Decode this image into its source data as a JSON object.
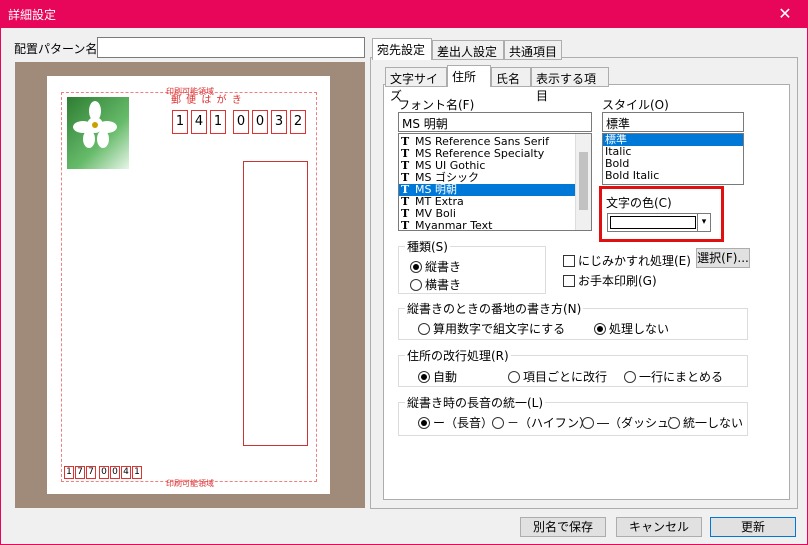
{
  "window": {
    "title": "詳細設定",
    "close_glyph": "✕"
  },
  "layout_label": "配置パターン名",
  "layout_value": "",
  "postcard": {
    "header_text": "郵 便 は が き",
    "top_label": "印刷可能領域",
    "bottom_label": "印刷可能領域",
    "zip_digits": [
      "1",
      "4",
      "1",
      "0",
      "0",
      "3",
      "2"
    ],
    "sender_zip_digits": [
      "1",
      "7",
      "7",
      "0",
      "0",
      "4",
      "1"
    ]
  },
  "outer_tabs": [
    "宛先設定",
    "差出人設定",
    "共通項目"
  ],
  "inner_tabs": [
    "文字サイズ",
    "住所",
    "氏名",
    "表示する項目"
  ],
  "font": {
    "label": "フォント名(F)",
    "value": "MS 明朝",
    "list": [
      "MS Reference Sans Serif",
      "MS Reference Specialty",
      "MS UI Gothic",
      "MS ゴシック",
      "MS 明朝",
      "MT Extra",
      "MV Boli",
      "Myanmar Text"
    ],
    "selected_index": 4
  },
  "style": {
    "label": "スタイル(O)",
    "value": "標準",
    "list": [
      "標準",
      "Italic",
      "Bold",
      "Bold Italic"
    ],
    "selected_index": 0
  },
  "color": {
    "label": "文字の色(C)",
    "value_hex": "#ffffff",
    "arrow": "▾",
    "highlight_hex": "#e01010"
  },
  "kind": {
    "label": "種類(S)",
    "options": [
      "縦書き",
      "横書き"
    ],
    "selected_index": 0
  },
  "checks": {
    "blur": "にじみかすれ処理(E)",
    "blur_button": "選択(F)...",
    "model_print": "お手本印刷(G)"
  },
  "banchi": {
    "label": "縦書きのときの番地の書き方(N)",
    "options": [
      "算用数字で組文字にする",
      "処理しない"
    ],
    "selected_index": 1
  },
  "linebreak": {
    "label": "住所の改行処理(R)",
    "options": [
      "自動",
      "項目ごとに改行",
      "一行にまとめる"
    ],
    "selected_index": 0
  },
  "longvowel": {
    "label": "縦書き時の長音の統一(L)",
    "options": [
      "ー（長音）",
      "－（ハイフン）",
      "―（ダッシュ）",
      "統一しない"
    ],
    "selected_index": 0
  },
  "footer": {
    "save_as": "別名で保存",
    "cancel": "キャンセル",
    "update": "更新"
  }
}
